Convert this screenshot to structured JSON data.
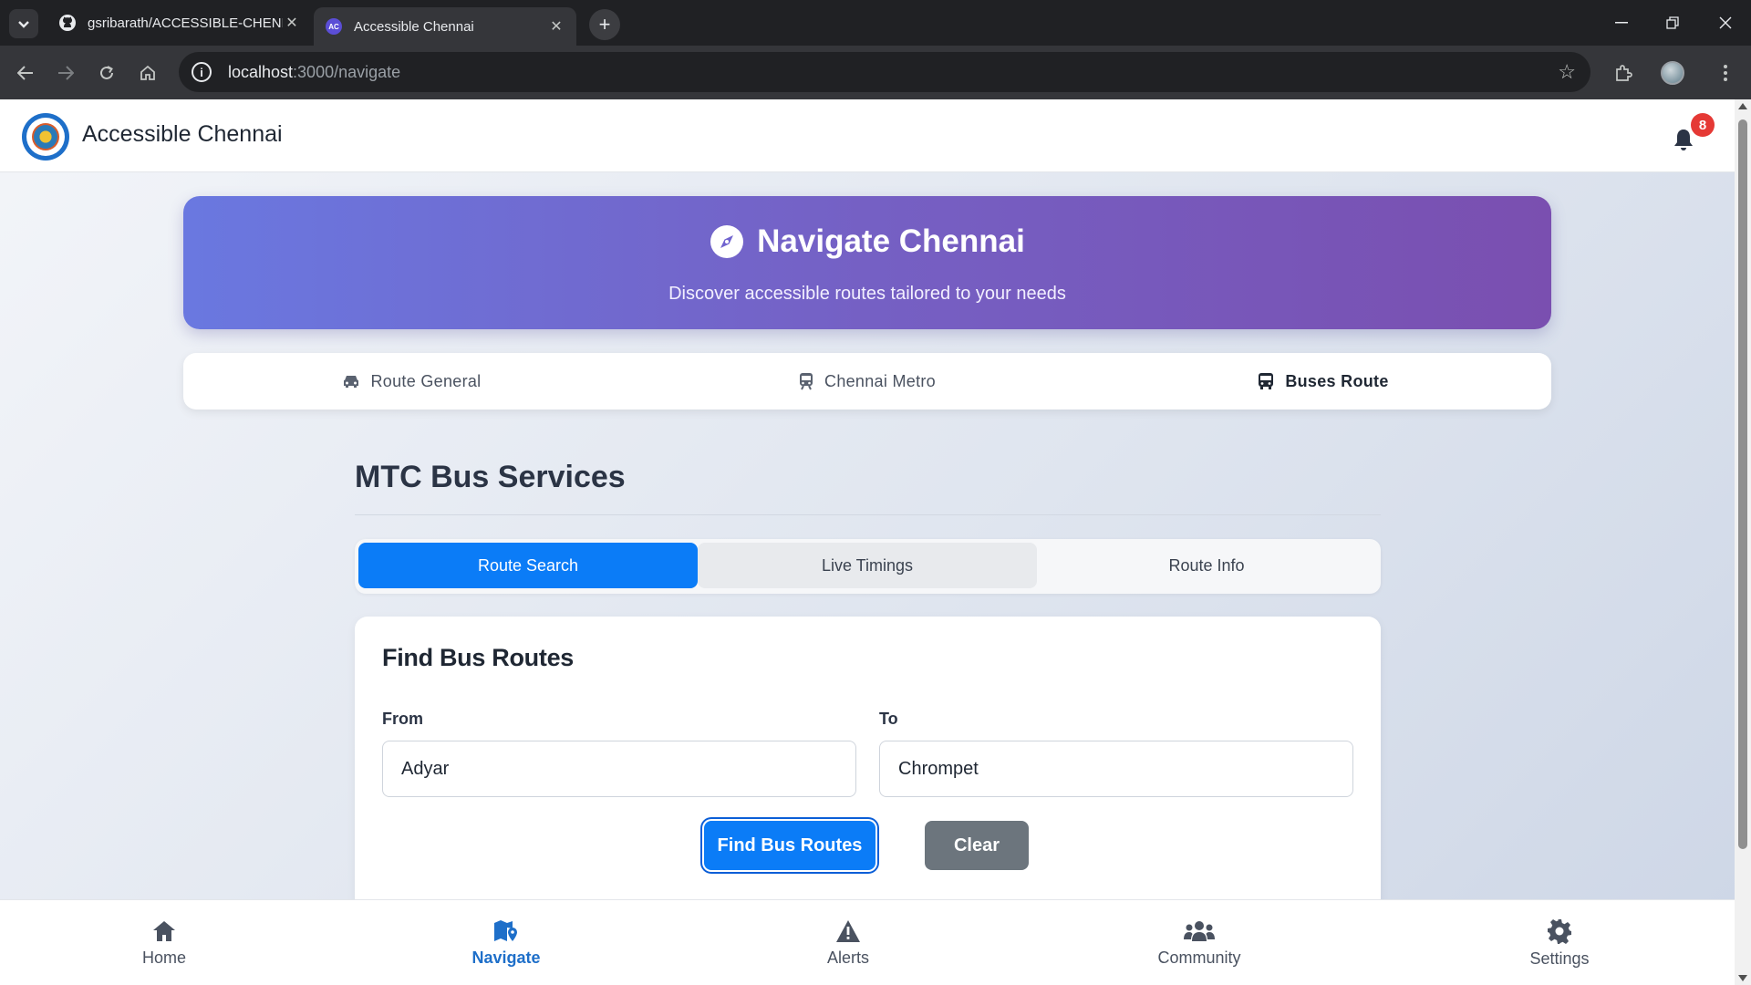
{
  "browser": {
    "tabs": [
      {
        "title": "gsribarath/ACCESSIBLE-CHENN",
        "icon": "github-icon"
      },
      {
        "title": "Accessible Chennai",
        "icon": "ac-favicon",
        "favicon_text": "AC"
      }
    ],
    "url_host": "localhost",
    "url_rest": ":3000/navigate"
  },
  "app": {
    "brand": "Accessible Chennai",
    "notifications_count": "8"
  },
  "hero": {
    "title": "Navigate Chennai",
    "subtitle": "Discover accessible routes tailored to your needs"
  },
  "mode_tabs": [
    {
      "label": "Route General",
      "icon": "car-icon",
      "active": false
    },
    {
      "label": "Chennai Metro",
      "icon": "train-icon",
      "active": false
    },
    {
      "label": "Buses Route",
      "icon": "bus-icon",
      "active": true
    }
  ],
  "section": {
    "title": "MTC Bus Services"
  },
  "sub_tabs": [
    {
      "label": "Route Search",
      "active": true
    },
    {
      "label": "Live Timings",
      "active": false
    },
    {
      "label": "Route Info",
      "active": false
    }
  ],
  "finder": {
    "title": "Find Bus Routes",
    "from_label": "From",
    "from_value": "Adyar",
    "to_label": "To",
    "to_value": "Chrompet",
    "find_button": "Find Bus Routes",
    "clear_button": "Clear"
  },
  "bottom_nav": [
    {
      "label": "Home",
      "icon": "home-icon",
      "active": false
    },
    {
      "label": "Navigate",
      "icon": "map-marker-icon",
      "active": true
    },
    {
      "label": "Alerts",
      "icon": "warning-icon",
      "active": false
    },
    {
      "label": "Community",
      "icon": "users-icon",
      "active": false
    },
    {
      "label": "Settings",
      "icon": "gear-icon",
      "active": false
    }
  ],
  "colors": {
    "primary": "#0b7cf7",
    "hero_start": "#6a78e0",
    "hero_end": "#7a4fb0",
    "nav_active": "#1e6fc9",
    "badge": "#e53935",
    "secondary_button": "#6c757d"
  }
}
